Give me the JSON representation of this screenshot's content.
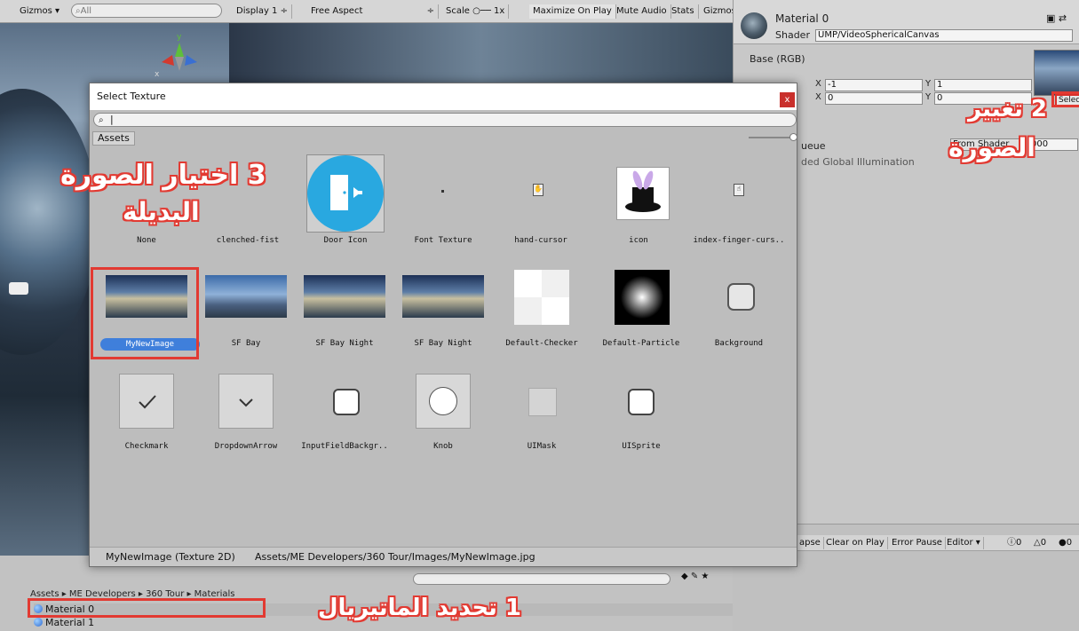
{
  "scene": {
    "gizmos_label": "Gizmos",
    "search_placeholder": "All",
    "axis_y": "y",
    "axis_x": "x"
  },
  "game": {
    "display": "Display 1",
    "aspect": "Free Aspect",
    "scale_label": "Scale",
    "scale_value": "1x",
    "maximize": "Maximize On Play",
    "mute": "Mute Audio",
    "stats": "Stats",
    "gizmos": "Gizmos"
  },
  "inspector": {
    "material_name": "Material 0",
    "shader_label": "Shader",
    "shader_value": "UMP/VideoSphericalCanvas",
    "base_label": "Base (RGB)",
    "tiling_x_label": "X",
    "tiling_x": "-1",
    "tiling_y_label": "Y",
    "tiling_y": "1",
    "offset_x_label": "X",
    "offset_x": "0",
    "offset_y_label": "Y",
    "offset_y": "0",
    "select_label": "Select",
    "queue_label": "ueue",
    "queue_dropdown": "From Shader",
    "queue_value": "000",
    "gi_label": "ded Global Illumination"
  },
  "console": {
    "collapse": "apse",
    "clear_on_play": "Clear on Play",
    "error_pause": "Error Pause",
    "editor": "Editor",
    "count_info": "0",
    "count_warn": "0",
    "count_error": "0"
  },
  "project": {
    "breadcrumb": "Assets ▸ ME Developers ▸ 360 Tour ▸ Materials",
    "items": [
      {
        "label": "Material 0"
      },
      {
        "label": "Material 1"
      }
    ]
  },
  "dialog": {
    "title": "Select Texture",
    "close_label": "x",
    "search_value": "|",
    "tab_label": "Assets",
    "footer_name": "MyNewImage (Texture 2D)",
    "footer_path": "Assets/ME Developers/360 Tour/Images/MyNewImage.jpg",
    "items": [
      {
        "label": "None",
        "icon": "none"
      },
      {
        "label": "clenched-fist",
        "icon": "fist-icon"
      },
      {
        "label": "Door Icon",
        "icon": "door-icon"
      },
      {
        "label": "Font Texture",
        "icon": "dot-icon"
      },
      {
        "label": "hand-cursor",
        "icon": "hand-cursor-icon"
      },
      {
        "label": "icon",
        "icon": "magic-hat-icon"
      },
      {
        "label": "index-finger-curs..",
        "icon": "index-finger-icon"
      },
      {
        "label": "MyNewImage",
        "icon": "panorama-thumb",
        "selected": true
      },
      {
        "label": "SF Bay",
        "icon": "panorama-thumb"
      },
      {
        "label": "SF Bay Night",
        "icon": "panorama-thumb"
      },
      {
        "label": "SF Bay Night",
        "icon": "panorama-thumb"
      },
      {
        "label": "Default-Checker",
        "icon": "checker-thumb"
      },
      {
        "label": "Default-Particle",
        "icon": "particle-thumb"
      },
      {
        "label": "Background",
        "icon": "rounded-box-icon"
      },
      {
        "label": "Checkmark",
        "icon": "checkmark-icon"
      },
      {
        "label": "DropdownArrow",
        "icon": "chevron-down-icon"
      },
      {
        "label": "InputFieldBackgr..",
        "icon": "rounded-box-icon"
      },
      {
        "label": "Knob",
        "icon": "circle-icon"
      },
      {
        "label": "UIMask",
        "icon": "square-icon"
      },
      {
        "label": "UISprite",
        "icon": "rounded-box-icon"
      }
    ]
  },
  "annotations": {
    "step1": "1 تحديد الماتيريال",
    "step2_line1": "2 تغيير",
    "step2_line2": "الصورة",
    "step3_line1": "3 اختيار الصورة",
    "step3_line2": "البديلة"
  },
  "colors": {
    "annotation_red": "#e23a32",
    "selection_blue": "#3f7fdb",
    "door_icon_blue": "#29a8e0"
  }
}
